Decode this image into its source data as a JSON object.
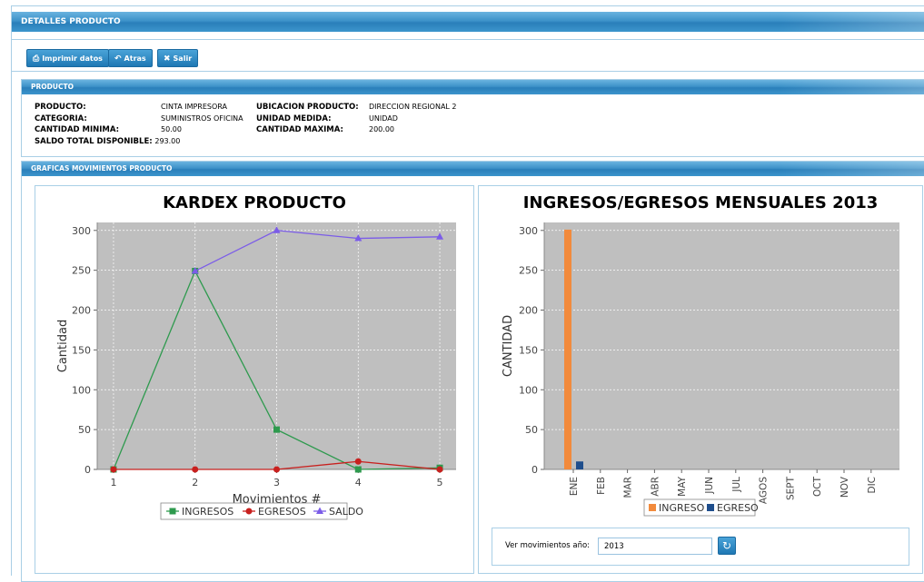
{
  "header": {
    "title": "DETALLES PRODUCTO"
  },
  "toolbar": {
    "print_label": "Imprimir datos",
    "back_label": "Atras",
    "exit_label": "Salir"
  },
  "producto": {
    "section_title": "PRODUCTO",
    "producto_label": "PRODUCTO:",
    "producto_value": "CINTA IMPRESORA",
    "categoria_label": "CATEGORIA:",
    "categoria_value": "SUMINISTROS OFICINA",
    "cantidad_minima_label": "CANTIDAD MINIMA:",
    "cantidad_minima_value": "50.00",
    "saldo_label": "SALDO TOTAL DISPONIBLE:",
    "saldo_value": "293.00",
    "ubicacion_label": "UBICACION PRODUCTO:",
    "ubicacion_value": "DIRECCION REGIONAL 2",
    "unidad_label": "UNIDAD MEDIDA:",
    "unidad_value": "UNIDAD",
    "cantidad_maxima_label": "CANTIDAD MAXIMA:",
    "cantidad_maxima_value": "200.00"
  },
  "graficas": {
    "section_title": "GRAFICAS MOVIMIENTOS PRODUCTO"
  },
  "year_filter": {
    "label": "Ver movimientos año:",
    "value": "2013"
  },
  "colors": {
    "ingresos": "#2e9a4e",
    "egresos": "#c8201e",
    "saldo": "#7b5ce8",
    "ingreso_bar": "#f28a3c",
    "egreso_bar": "#1f4e8c",
    "plot_bg": "#bfbfbf"
  },
  "chart_data": [
    {
      "type": "line",
      "title": "KARDEX PRODUCTO",
      "xlabel": "Movimientos #",
      "ylabel": "Cantidad",
      "x": [
        1,
        2,
        3,
        4,
        5
      ],
      "xlim": [
        0.8,
        5.2
      ],
      "ylim": [
        0,
        310
      ],
      "yticks": [
        0,
        50,
        100,
        150,
        200,
        250,
        300
      ],
      "grid": true,
      "legend": "bottom",
      "series": [
        {
          "name": "INGRESOS",
          "values": [
            0,
            249,
            50,
            0,
            2
          ],
          "marker": "square"
        },
        {
          "name": "EGRESOS",
          "values": [
            0,
            0,
            0,
            10,
            0
          ],
          "marker": "circle"
        },
        {
          "name": "SALDO",
          "values": [
            null,
            249,
            300,
            290,
            292
          ],
          "marker": "triangle"
        }
      ]
    },
    {
      "type": "bar",
      "title": "INGRESOS/EGRESOS MENSUALES 2013",
      "xlabel": "",
      "ylabel": "CANTIDAD",
      "categories": [
        "ENE",
        "FEB",
        "MAR",
        "ABR",
        "MAY",
        "JUN",
        "JUL",
        "AGOS",
        "SEPT",
        "OCT",
        "NOV",
        "DIC"
      ],
      "ylim": [
        0,
        310
      ],
      "yticks": [
        0,
        50,
        100,
        150,
        200,
        250,
        300
      ],
      "grid": true,
      "legend": "bottom",
      "series": [
        {
          "name": "INGRESO",
          "values": [
            301,
            0,
            0,
            0,
            0,
            0,
            0,
            0,
            0,
            0,
            0,
            0
          ]
        },
        {
          "name": "EGRESO",
          "values": [
            10,
            0,
            0,
            0,
            0,
            0,
            0,
            0,
            0,
            0,
            0,
            0
          ]
        }
      ]
    }
  ]
}
